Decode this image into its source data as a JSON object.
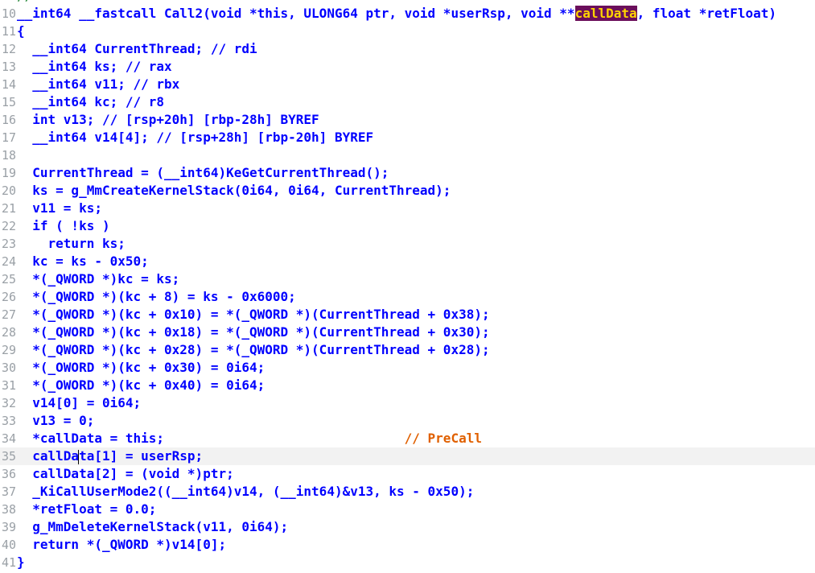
{
  "editor": {
    "first_line_fragment": "//",
    "lines": [
      {
        "n": "10",
        "text": "__int64 __fastcall Call2(void *this, ULONG64 ptr, void *userRsp, void **callData, float *retFloat)"
      },
      {
        "n": "11",
        "text": "{"
      },
      {
        "n": "12",
        "text": "  __int64 CurrentThread; // rdi"
      },
      {
        "n": "13",
        "text": "  __int64 ks; // rax"
      },
      {
        "n": "14",
        "text": "  __int64 v11; // rbx"
      },
      {
        "n": "15",
        "text": "  __int64 kc; // r8"
      },
      {
        "n": "16",
        "text": "  int v13; // [rsp+20h] [rbp-28h] BYREF"
      },
      {
        "n": "17",
        "text": "  __int64 v14[4]; // [rsp+28h] [rbp-20h] BYREF"
      },
      {
        "n": "18",
        "text": ""
      },
      {
        "n": "19",
        "text": "  CurrentThread = (__int64)KeGetCurrentThread();"
      },
      {
        "n": "20",
        "text": "  ks = g_MmCreateKernelStack(0i64, 0i64, CurrentThread);"
      },
      {
        "n": "21",
        "text": "  v11 = ks;"
      },
      {
        "n": "22",
        "text": "  if ( !ks )"
      },
      {
        "n": "23",
        "text": "    return ks;"
      },
      {
        "n": "24",
        "text": "  kc = ks - 0x50;"
      },
      {
        "n": "25",
        "text": "  *(_QWORD *)kc = ks;"
      },
      {
        "n": "26",
        "text": "  *(_QWORD *)(kc + 8) = ks - 0x6000;"
      },
      {
        "n": "27",
        "text": "  *(_QWORD *)(kc + 0x10) = *(_QWORD *)(CurrentThread + 0x38);"
      },
      {
        "n": "28",
        "text": "  *(_QWORD *)(kc + 0x18) = *(_QWORD *)(CurrentThread + 0x30);"
      },
      {
        "n": "29",
        "text": "  *(_QWORD *)(kc + 0x28) = *(_QWORD *)(CurrentThread + 0x28);"
      },
      {
        "n": "30",
        "text": "  *(_OWORD *)(kc + 0x30) = 0i64;"
      },
      {
        "n": "31",
        "text": "  *(_OWORD *)(kc + 0x40) = 0i64;"
      },
      {
        "n": "32",
        "text": "  v14[0] = 0i64;"
      },
      {
        "n": "33",
        "text": "  v13 = 0;"
      },
      {
        "n": "34",
        "text": "  *callData = this;                               // PreCall"
      },
      {
        "n": "35",
        "text": "  callData[1] = userRsp;"
      },
      {
        "n": "36",
        "text": "  callData[2] = (void *)ptr;"
      },
      {
        "n": "37",
        "text": "  _KiCallUserMode2((__int64)v14, (__int64)&v13, ks - 0x50);"
      },
      {
        "n": "38",
        "text": "  *retFloat = 0.0;"
      },
      {
        "n": "39",
        "text": "  g_MmDeleteKernelStack(v11, 0i64);"
      },
      {
        "n": "40",
        "text": "  return *(_QWORD *)v14[0];"
      },
      {
        "n": "41",
        "text": "}"
      }
    ],
    "current_line": "35",
    "highlighted_identifier": "callData",
    "comment_text": "// PreCall",
    "colors": {
      "background": "#ffffff",
      "code_text": "#0000ff",
      "line_numbers": "#9aa0a6",
      "current_line_bg": "#f2f2f2",
      "highlight_bg": "#6b0f5b",
      "highlight_fg": "#ffd400",
      "comment": "#e06000"
    }
  }
}
